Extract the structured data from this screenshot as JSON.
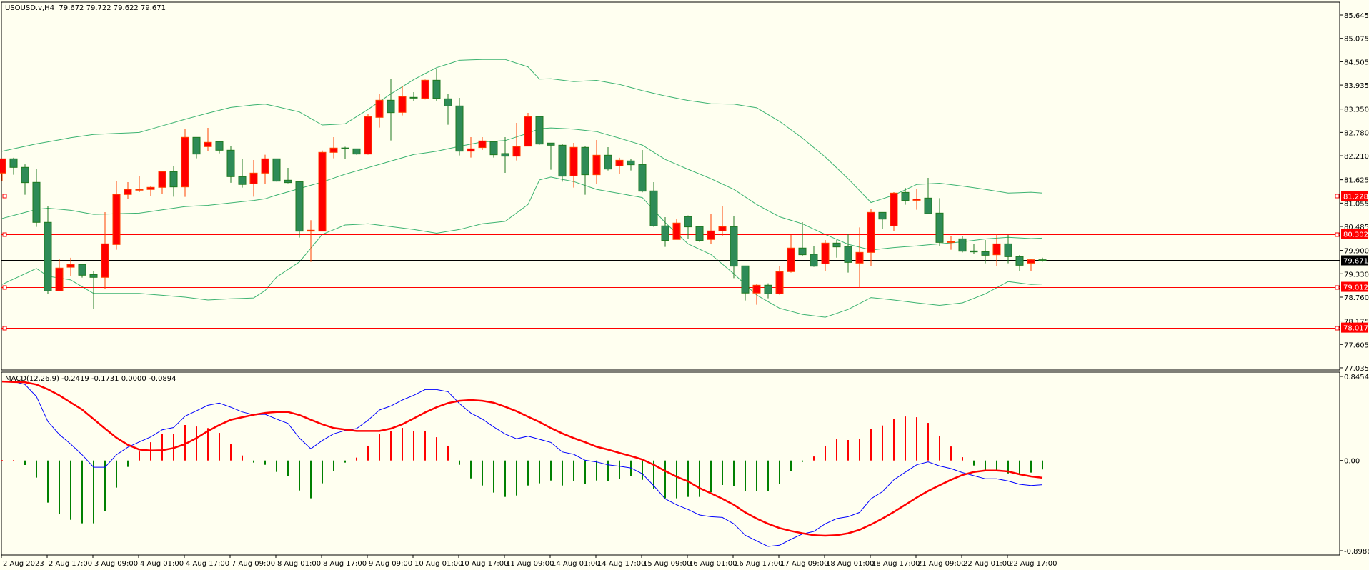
{
  "header": {
    "symbol": "USOUSD.v,H4",
    "open": "79.672",
    "high": "79.722",
    "low": "79.622",
    "close": "79.671"
  },
  "macd_header": {
    "name": "MACD(12,26,9)",
    "v1": "-0.2419",
    "v2": "-0.1731",
    "v3": "0.0000",
    "v4": "-0.0894"
  },
  "colors": {
    "background": "#fffff0",
    "bull_body": "#ff0000",
    "bull_border": "#ff4000",
    "bear_body": "#2e8b57",
    "bear_border": "#1f7a1f",
    "bands": "#3cb371",
    "macd_line": "#0000ff",
    "signal_line": "#ff0000",
    "hist_pos": "#ff0000",
    "hist_neg": "#008000",
    "level_line": "#ff0000",
    "current_line": "#000000"
  },
  "chart_data": [
    {
      "type": "candlestick",
      "title": "USOUSD.v,H4",
      "ylim": [
        77.035,
        85.645
      ],
      "price_axis": {
        "ticks": [
          "85.645",
          "85.075",
          "84.505",
          "83.935",
          "83.350",
          "82.780",
          "82.210",
          "81.625",
          "81.055",
          "80.485",
          "79.900",
          "79.330",
          "78.760",
          "78.175",
          "77.605",
          "77.035"
        ]
      },
      "levels": [
        {
          "value": 81.228,
          "label": "81.228"
        },
        {
          "value": 80.302,
          "label": "80.302"
        },
        {
          "value": 79.012,
          "label": "79.012"
        },
        {
          "value": 78.017,
          "label": "78.017"
        }
      ],
      "current_price": {
        "value": 79.671,
        "label": "79.671"
      },
      "time_axis": {
        "labels": [
          "2 Aug 2023",
          "2 Aug 17:00",
          "3 Aug 09:00",
          "4 Aug 01:00",
          "4 Aug 17:00",
          "7 Aug 09:00",
          "8 Aug 01:00",
          "8 Aug 17:00",
          "9 Aug 09:00",
          "10 Aug 01:00",
          "10 Aug 17:00",
          "11 Aug 09:00",
          "14 Aug 01:00",
          "14 Aug 17:00",
          "15 Aug 09:00",
          "16 Aug 01:00",
          "16 Aug 17:00",
          "17 Aug 09:00",
          "18 Aug 01:00",
          "18 Aug 17:00",
          "21 Aug 09:00",
          "22 Aug 01:00",
          "22 Aug 17:00"
        ],
        "bars_per_label": 4
      },
      "ohlc": [
        [
          81.787,
          82.136,
          81.596,
          82.136
        ],
        [
          82.136,
          82.16,
          81.747,
          81.927
        ],
        [
          81.927,
          82.0,
          81.259,
          81.555
        ],
        [
          81.561,
          81.898,
          80.474,
          80.585
        ],
        [
          80.585,
          80.986,
          78.836,
          78.912
        ],
        [
          78.912,
          79.696,
          78.91,
          79.47
        ],
        [
          79.49,
          79.72,
          79.27,
          79.557
        ],
        [
          79.557,
          79.58,
          79.237,
          79.295
        ],
        [
          79.31,
          79.388,
          78.47,
          79.243
        ],
        [
          79.243,
          80.835,
          78.964,
          80.062
        ],
        [
          80.044,
          81.584,
          79.917,
          81.265
        ],
        [
          81.265,
          81.567,
          81.154,
          81.387
        ],
        [
          81.37,
          81.706,
          81.323,
          81.39
        ],
        [
          81.387,
          81.48,
          81.236,
          81.439
        ],
        [
          81.439,
          81.822,
          81.27,
          81.822
        ],
        [
          81.822,
          81.95,
          81.21,
          81.45
        ],
        [
          81.45,
          82.874,
          81.206,
          82.659
        ],
        [
          82.659,
          82.659,
          82.148,
          82.252
        ],
        [
          82.432,
          82.891,
          82.322,
          82.537
        ],
        [
          82.554,
          82.554,
          82.27,
          82.345
        ],
        [
          82.345,
          82.45,
          81.55,
          81.7
        ],
        [
          81.7,
          82.14,
          81.433,
          81.51
        ],
        [
          81.526,
          82.107,
          81.212,
          81.787
        ],
        [
          81.787,
          82.235,
          81.52,
          82.136
        ],
        [
          82.136,
          82.136,
          81.58,
          81.59
        ],
        [
          81.613,
          81.915,
          81.538,
          81.555
        ],
        [
          81.578,
          81.578,
          80.213,
          80.37
        ],
        [
          80.37,
          80.637,
          79.62,
          80.393
        ],
        [
          80.37,
          82.34,
          80.37,
          82.293
        ],
        [
          82.293,
          82.665,
          82.148,
          82.398
        ],
        [
          82.4,
          82.43,
          82.13,
          82.38
        ],
        [
          82.38,
          82.38,
          82.235,
          82.252
        ],
        [
          82.252,
          83.24,
          82.235,
          83.165
        ],
        [
          83.147,
          83.71,
          82.897,
          83.565
        ],
        [
          83.565,
          84.094,
          82.583,
          83.263
        ],
        [
          83.269,
          83.908,
          83.193,
          83.652
        ],
        [
          83.635,
          83.763,
          83.54,
          83.617
        ],
        [
          83.611,
          84.07,
          83.583,
          84.053
        ],
        [
          84.053,
          84.32,
          83.54,
          83.611
        ],
        [
          83.6,
          83.71,
          82.967,
          83.426
        ],
        [
          83.426,
          83.623,
          82.217,
          82.322
        ],
        [
          82.322,
          82.665,
          82.165,
          82.38
        ],
        [
          82.41,
          82.665,
          82.351,
          82.572
        ],
        [
          82.554,
          82.572,
          82.165,
          82.235
        ],
        [
          82.264,
          82.665,
          81.793,
          82.2
        ],
        [
          82.2,
          83.013,
          82.095,
          82.432
        ],
        [
          82.444,
          83.257,
          82.444,
          83.165
        ],
        [
          83.165,
          83.188,
          82.479,
          82.496
        ],
        [
          82.52,
          82.52,
          81.87,
          82.467
        ],
        [
          82.467,
          82.497,
          81.578,
          81.712
        ],
        [
          81.718,
          82.525,
          81.433,
          82.415
        ],
        [
          82.415,
          82.456,
          81.259,
          81.747
        ],
        [
          81.747,
          82.595,
          81.52,
          82.223
        ],
        [
          82.223,
          82.42,
          81.851,
          81.886
        ],
        [
          81.962,
          82.16,
          81.764,
          82.1
        ],
        [
          82.084,
          82.142,
          81.851,
          81.991
        ],
        [
          81.997,
          82.351,
          81.317,
          81.346
        ],
        [
          81.352,
          81.567,
          80.475,
          80.498
        ],
        [
          80.498,
          80.713,
          79.987,
          80.143
        ],
        [
          80.167,
          80.678,
          80.167,
          80.568
        ],
        [
          80.725,
          80.754,
          80.172,
          80.475
        ],
        [
          80.48,
          80.48,
          80.108,
          80.143
        ],
        [
          80.167,
          80.783,
          80.056,
          80.376
        ],
        [
          80.376,
          80.974,
          80.26,
          80.48
        ],
        [
          80.48,
          80.742,
          79.225,
          79.516
        ],
        [
          79.522,
          79.522,
          78.68,
          78.86
        ],
        [
          78.86,
          79.086,
          78.575,
          79.051
        ],
        [
          79.051,
          79.098,
          78.732,
          78.842
        ],
        [
          78.842,
          79.51,
          78.819,
          79.382
        ],
        [
          79.382,
          80.277,
          79.359,
          79.958
        ],
        [
          79.958,
          80.591,
          79.771,
          79.795
        ],
        [
          79.806,
          79.997,
          79.498,
          79.515
        ],
        [
          79.573,
          80.154,
          79.393,
          80.079
        ],
        [
          80.079,
          80.154,
          79.724,
          79.986
        ],
        [
          79.997,
          80.299,
          79.358,
          79.608
        ],
        [
          79.59,
          80.462,
          78.998,
          79.852
        ],
        [
          79.852,
          80.921,
          79.515,
          80.828
        ],
        [
          80.828,
          80.828,
          80.421,
          80.665
        ],
        [
          80.497,
          81.322,
          80.369,
          81.299
        ],
        [
          81.316,
          81.426,
          81.014,
          81.119
        ],
        [
          81.124,
          81.392,
          80.892,
          81.153
        ],
        [
          81.177,
          81.671,
          80.787,
          80.799
        ],
        [
          80.811,
          81.177,
          80.003,
          80.096
        ],
        [
          80.096,
          80.241,
          79.916,
          80.113
        ],
        [
          80.183,
          80.241,
          79.852,
          79.881
        ],
        [
          79.887,
          80.049,
          79.811,
          79.864
        ],
        [
          79.869,
          80.154,
          79.585,
          79.782
        ],
        [
          79.794,
          80.299,
          79.527,
          80.061
        ],
        [
          80.061,
          80.276,
          79.585,
          79.747
        ],
        [
          79.747,
          79.788,
          79.393,
          79.538
        ],
        [
          79.59,
          79.683,
          79.393,
          79.672
        ],
        [
          79.672,
          79.722,
          79.622,
          79.671
        ]
      ],
      "bollinger_samples": [
        [
          0,
          82.32,
          80.68,
          79.07
        ],
        [
          3,
          82.5,
          80.9,
          79.46
        ],
        [
          4,
          82.55,
          80.93,
          79.27
        ],
        [
          6,
          82.65,
          80.88,
          79.18
        ],
        [
          8,
          82.73,
          80.78,
          78.85
        ],
        [
          12,
          82.78,
          80.81,
          78.85
        ],
        [
          16,
          83.1,
          80.97,
          78.76
        ],
        [
          18,
          83.25,
          81.0,
          78.69
        ],
        [
          20,
          83.39,
          81.06,
          78.72
        ],
        [
          22,
          83.45,
          81.12,
          78.74
        ],
        [
          23,
          83.47,
          81.16,
          78.92
        ],
        [
          24,
          83.41,
          81.25,
          79.25
        ],
        [
          26,
          83.28,
          81.41,
          79.62
        ],
        [
          28,
          82.96,
          81.57,
          80.29
        ],
        [
          30,
          82.99,
          81.76,
          80.52
        ],
        [
          32,
          83.34,
          81.92,
          80.55
        ],
        [
          34,
          83.72,
          82.08,
          80.48
        ],
        [
          36,
          84.07,
          82.24,
          80.41
        ],
        [
          38,
          84.36,
          82.32,
          80.32
        ],
        [
          40,
          84.54,
          82.44,
          80.41
        ],
        [
          42,
          84.56,
          82.55,
          80.55
        ],
        [
          44,
          84.56,
          82.58,
          80.61
        ],
        [
          46,
          84.38,
          82.76,
          81.02
        ],
        [
          47,
          84.08,
          82.87,
          81.62
        ],
        [
          48,
          84.09,
          82.89,
          81.69
        ],
        [
          50,
          84.02,
          82.86,
          81.58
        ],
        [
          52,
          84.05,
          82.8,
          81.39
        ],
        [
          54,
          83.95,
          82.64,
          81.29
        ],
        [
          56,
          83.8,
          82.47,
          81.19
        ],
        [
          58,
          83.67,
          82.12,
          80.58
        ],
        [
          60,
          83.56,
          81.88,
          80.06
        ],
        [
          62,
          83.48,
          81.65,
          79.8
        ],
        [
          64,
          83.47,
          81.39,
          79.33
        ],
        [
          66,
          83.38,
          81.02,
          78.81
        ],
        [
          68,
          83.05,
          80.72,
          78.49
        ],
        [
          70,
          82.64,
          80.55,
          78.34
        ],
        [
          72,
          82.18,
          80.29,
          78.27
        ],
        [
          74,
          81.65,
          80.05,
          78.46
        ],
        [
          76,
          81.07,
          79.91,
          78.75
        ],
        [
          78,
          81.25,
          79.97,
          78.69
        ],
        [
          80,
          81.51,
          80.01,
          78.62
        ],
        [
          82,
          81.54,
          80.06,
          78.56
        ],
        [
          84,
          81.47,
          80.11,
          78.62
        ],
        [
          86,
          81.39,
          80.18,
          78.84
        ],
        [
          88,
          81.3,
          80.22,
          79.14
        ],
        [
          90,
          81.32,
          80.19,
          79.07
        ],
        [
          91,
          81.3,
          80.2,
          79.08
        ]
      ]
    },
    {
      "type": "line",
      "title": "MACD(12,26,9)",
      "ylim": [
        -0.8986,
        0.8454
      ],
      "axis_ticks": [
        "0.8454",
        "0.00",
        "-0.8986"
      ],
      "histogram": [
        0.005,
        0.005,
        -0.045,
        -0.171,
        -0.421,
        -0.538,
        -0.593,
        -0.628,
        -0.628,
        -0.507,
        -0.271,
        -0.064,
        0.09,
        0.183,
        0.269,
        0.269,
        0.355,
        0.34,
        0.324,
        0.276,
        0.162,
        0.05,
        -0.021,
        -0.043,
        -0.114,
        -0.157,
        -0.3,
        -0.378,
        -0.228,
        -0.107,
        -0.021,
        0.029,
        0.148,
        0.262,
        0.298,
        0.326,
        0.298,
        0.298,
        0.233,
        0.148,
        -0.043,
        -0.179,
        -0.25,
        -0.321,
        -0.364,
        -0.35,
        -0.25,
        -0.228,
        -0.2,
        -0.25,
        -0.207,
        -0.236,
        -0.2,
        -0.207,
        -0.186,
        -0.157,
        -0.193,
        -0.286,
        -0.378,
        -0.378,
        -0.364,
        -0.364,
        -0.317,
        -0.245,
        -0.257,
        -0.307,
        -0.307,
        -0.307,
        -0.236,
        -0.107,
        -0.014,
        0.04,
        0.148,
        0.212,
        0.205,
        0.219,
        0.314,
        0.35,
        0.419,
        0.44,
        0.433,
        0.376,
        0.248,
        0.14,
        0.033,
        -0.05,
        -0.107,
        -0.107,
        -0.129,
        -0.136,
        -0.121,
        -0.0894
      ],
      "macd": [
        0.79,
        0.79,
        0.76,
        0.64,
        0.39,
        0.26,
        0.164,
        0.057,
        -0.067,
        -0.067,
        0.057,
        0.133,
        0.186,
        0.236,
        0.307,
        0.33,
        0.443,
        0.497,
        0.552,
        0.574,
        0.533,
        0.486,
        0.457,
        0.462,
        0.414,
        0.371,
        0.224,
        0.117,
        0.2,
        0.267,
        0.3,
        0.319,
        0.402,
        0.505,
        0.545,
        0.605,
        0.652,
        0.709,
        0.709,
        0.688,
        0.569,
        0.474,
        0.414,
        0.336,
        0.264,
        0.217,
        0.243,
        0.212,
        0.181,
        0.086,
        0.062,
        0.002,
        -0.014,
        -0.043,
        -0.057,
        -0.074,
        -0.133,
        -0.252,
        -0.383,
        -0.443,
        -0.49,
        -0.545,
        -0.562,
        -0.569,
        -0.633,
        -0.747,
        -0.804,
        -0.859,
        -0.847,
        -0.788,
        -0.735,
        -0.709,
        -0.633,
        -0.581,
        -0.562,
        -0.519,
        -0.383,
        -0.312,
        -0.193,
        -0.117,
        -0.043,
        -0.014,
        -0.055,
        -0.081,
        -0.121,
        -0.152,
        -0.183,
        -0.183,
        -0.205,
        -0.238,
        -0.25,
        -0.2419
      ],
      "signal": [
        0.79,
        0.785,
        0.783,
        0.76,
        0.712,
        0.652,
        0.58,
        0.509,
        0.414,
        0.319,
        0.228,
        0.157,
        0.109,
        0.1,
        0.102,
        0.124,
        0.164,
        0.224,
        0.295,
        0.355,
        0.407,
        0.433,
        0.457,
        0.476,
        0.486,
        0.486,
        0.455,
        0.407,
        0.362,
        0.324,
        0.309,
        0.295,
        0.295,
        0.295,
        0.319,
        0.362,
        0.421,
        0.481,
        0.533,
        0.574,
        0.597,
        0.605,
        0.597,
        0.578,
        0.538,
        0.493,
        0.438,
        0.386,
        0.324,
        0.271,
        0.224,
        0.183,
        0.138,
        0.109,
        0.076,
        0.045,
        0.01,
        -0.043,
        -0.105,
        -0.162,
        -0.209,
        -0.276,
        -0.328,
        -0.383,
        -0.443,
        -0.519,
        -0.581,
        -0.633,
        -0.676,
        -0.704,
        -0.728,
        -0.747,
        -0.752,
        -0.747,
        -0.728,
        -0.693,
        -0.64,
        -0.581,
        -0.514,
        -0.443,
        -0.371,
        -0.305,
        -0.248,
        -0.193,
        -0.145,
        -0.114,
        -0.1,
        -0.1,
        -0.109,
        -0.138,
        -0.159,
        -0.1731
      ]
    }
  ]
}
